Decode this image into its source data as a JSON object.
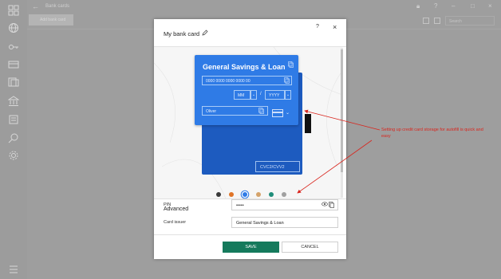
{
  "app": {
    "title": "Bank cards",
    "add_button_label": "Add bank card",
    "search_placeholder": "Search",
    "window_controls": [
      "lock-icon",
      "help-icon",
      "minimize-icon",
      "maximize-icon",
      "close-icon"
    ]
  },
  "rail": {
    "items": [
      "grid-icon",
      "globe-icon",
      "key-icon",
      "card-icon",
      "id-icon",
      "bank-icon",
      "note-icon",
      "search-person-icon",
      "gear-icon"
    ],
    "bottom": "menu-icon"
  },
  "dialog": {
    "title": "My bank card",
    "help": "?",
    "close": "×",
    "card": {
      "bank_name": "General Savings & Loan",
      "number_placeholder": "0000 0000 0000 0000 00",
      "month_placeholder": "MM",
      "year_placeholder": "YYYY",
      "separator": "/",
      "holder_name": "Oliver",
      "cvc_placeholder": "CVC2/CVV2",
      "color": "#2f7be6",
      "back_color": "#1d5bbf"
    },
    "color_options": [
      {
        "name": "dark",
        "color": "#3a3a3a",
        "selected": false
      },
      {
        "name": "orange",
        "color": "#e07427",
        "selected": false
      },
      {
        "name": "blue",
        "color": "#2f7be6",
        "selected": true
      },
      {
        "name": "tan",
        "color": "#d4a36b",
        "selected": false
      },
      {
        "name": "teal",
        "color": "#1f8d7a",
        "selected": false
      },
      {
        "name": "grey",
        "color": "#a0a0a0",
        "selected": false
      }
    ],
    "advanced": {
      "title": "Advanced",
      "pin_label": "PIN",
      "pin_value": "•••••",
      "issuer_label": "Card issuer",
      "issuer_value": "General Savings & Loan"
    },
    "save_label": "SAVE",
    "cancel_label": "CANCEL"
  },
  "annotation": {
    "text": "Setting up credit card storage for autofill is quick and easy",
    "color": "#d9251d"
  }
}
